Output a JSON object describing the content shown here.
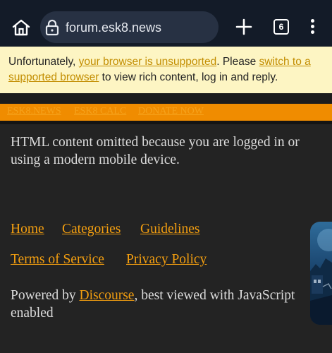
{
  "browser": {
    "url": "forum.esk8.news",
    "tab_count": "6",
    "home_icon": "home-icon",
    "lock_icon": "lock-icon",
    "new_tab_icon": "plus-icon",
    "menu_icon": "more-vert-icon"
  },
  "notice": {
    "text_1": "Unfortunately, ",
    "link_1": "your browser is unsupported",
    "text_2": ". Please ",
    "link_2": "switch to a supported browser",
    "text_3": " to view rich content, log in and reply."
  },
  "top_nav": {
    "links": [
      "ESK8.NEWS",
      "ESK8 CALC",
      "DONATE NOW"
    ]
  },
  "main": {
    "message": "HTML content omitted because you are logged in or using a modern mobile device."
  },
  "footer": {
    "links_row1": [
      "Home",
      "Categories",
      "Guidelines"
    ],
    "links_row2": [
      "Terms of Service",
      "Privacy Policy"
    ],
    "powered_prefix": "Powered by ",
    "powered_link": "Discourse",
    "powered_suffix": ", best viewed with JavaScript enabled"
  },
  "colors": {
    "toolbar_bg": "#131b28",
    "url_pill_bg": "#273143",
    "notice_bg": "#fdf5c3",
    "link_orange": "#f29e10",
    "nav_bar_orange": "#f08c00",
    "page_bg": "#232323"
  }
}
